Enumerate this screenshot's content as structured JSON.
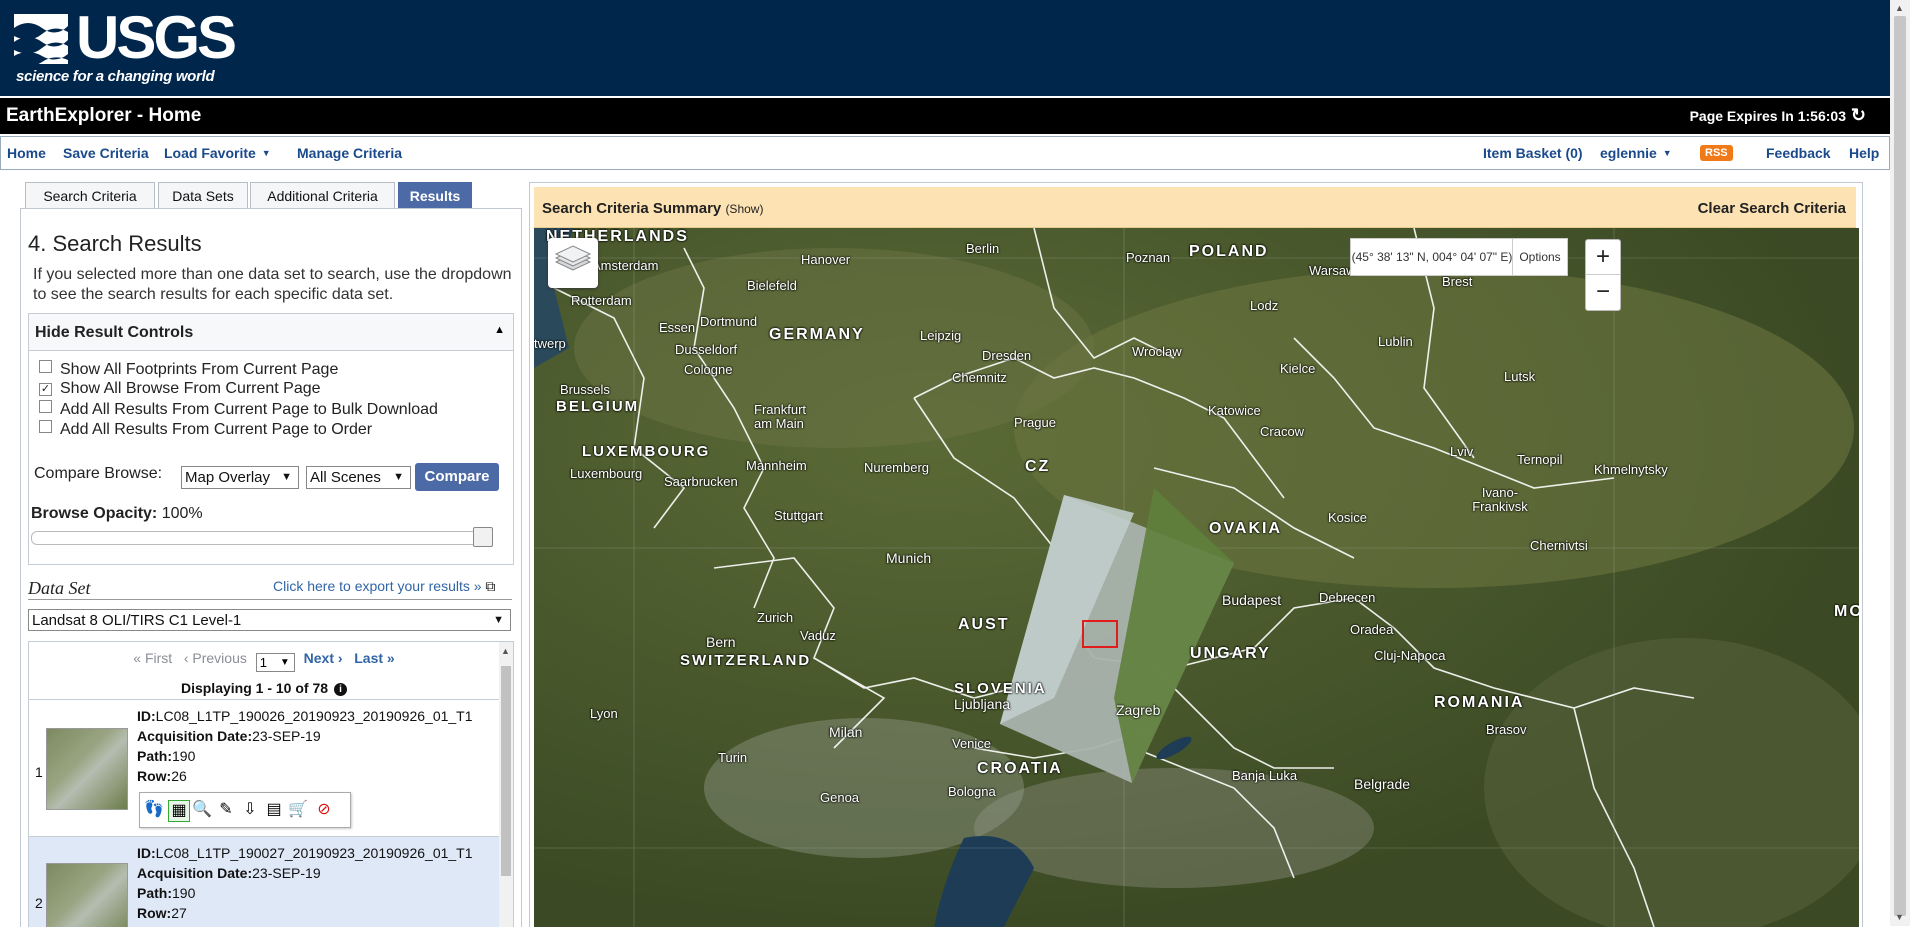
{
  "header": {
    "logo_text": "USGS",
    "logo_tagline": "science for a changing world",
    "app_title": "EarthExplorer - Home",
    "expiry_label": "Page Expires In 1:56:03",
    "refresh_icon": "refresh-icon"
  },
  "nav": {
    "home": "Home",
    "save_criteria": "Save Criteria",
    "load_favorite": "Load Favorite",
    "manage_criteria": "Manage Criteria",
    "item_basket": "Item Basket (0)",
    "user": "eglennie",
    "rss": "RSS",
    "feedback": "Feedback",
    "help": "Help"
  },
  "tabs": [
    {
      "label": "Search Criteria"
    },
    {
      "label": "Data Sets"
    },
    {
      "label": "Additional Criteria"
    },
    {
      "label": "Results",
      "active": true
    }
  ],
  "results_panel": {
    "title": "4. Search Results",
    "description": "If you selected more than one data set to search, use the dropdown to see the search results for each specific data set.",
    "controls_header": "Hide Result Controls",
    "checkboxes": [
      {
        "label": "Show All Footprints From Current Page",
        "checked": false
      },
      {
        "label": "Show All Browse From Current Page",
        "checked": true
      },
      {
        "label": "Add All Results From Current Page to Bulk Download",
        "checked": false
      },
      {
        "label": "Add All Results From Current Page to Order",
        "checked": false
      }
    ],
    "compare_label": "Compare Browse:",
    "compare_mode": "Map Overlay",
    "compare_scenes": "All Scenes",
    "compare_button": "Compare",
    "opacity_label": "Browse Opacity:",
    "opacity_value": "100%",
    "opacity_level": 1.0,
    "dataset_label": "Data Set",
    "export_link": "Click here to export your results »",
    "dataset_value": "Landsat 8 OLI/TIRS C1 Level-1",
    "pager": {
      "first": "« First",
      "previous": "‹ Previous",
      "page": "1",
      "next": "Next ›",
      "last": "Last »"
    },
    "displaying": "Displaying 1 - 10 of 78",
    "results": [
      {
        "num": "1",
        "id_label": "ID:",
        "id": "LC08_L1TP_190026_20190923_20190926_01_T1",
        "acq_label": "Acquisition Date:",
        "acq": "23-SEP-19",
        "path_label": "Path:",
        "path": "190",
        "row_label": "Row:",
        "row": "26"
      },
      {
        "num": "2",
        "id_label": "ID:",
        "id": "LC08_L1TP_190027_20190923_20190926_01_T1",
        "acq_label": "Acquisition Date:",
        "acq": "23-SEP-19",
        "path_label": "Path:",
        "path": "190",
        "row_label": "Row:",
        "row": "27"
      }
    ],
    "result_tool_icons": [
      "footprint-icon",
      "browse-overlay-icon",
      "show-metadata-icon",
      "compare-browse-icon",
      "download-icon",
      "bulk-download-icon",
      "add-to-cart-icon",
      "exclude-icon"
    ]
  },
  "map": {
    "summary_title": "Search Criteria Summary",
    "summary_toggle": "(Show)",
    "clear_label": "Clear Search Criteria",
    "coords": "(45° 38' 13\" N, 004° 04' 07\" E)",
    "options_label": "Options",
    "zoom_in": "+",
    "zoom_out": "−",
    "countries": [
      "NETHERLANDS",
      "POLAND",
      "GERMANY",
      "BELGIUM",
      "LUXEMBOURG",
      "CZ",
      "OVAKIA",
      "AUST",
      "UNGARY",
      "SWITZERLAND",
      "SLOVENIA",
      "ROMANIA",
      "CROATIA",
      "MO"
    ],
    "cities": [
      "Amsterdam",
      "Hanover",
      "Berlin",
      "Poznan",
      "Warsaw",
      "Brest",
      "Rotterdam",
      "Bielefeld",
      "Lodz",
      "Essen",
      "Dortmund",
      "Leipzig",
      "Dusseldorf",
      "Dresden",
      "Wroclaw",
      "Lublin",
      "twerp",
      "Cologne",
      "Chemnitz",
      "Kielce",
      "Lutsk",
      "Brussels",
      "Frankfurt am Main",
      "Katowice",
      "Prague",
      "Cracow",
      "Lviv",
      "Ternopil",
      "Khmelnytsky",
      "Luxembourg",
      "Saarbrucken",
      "Mannheim",
      "Nuremberg",
      "Ivano-Frankivsk",
      "Stuttgart",
      "Kosice",
      "Chernivtsi",
      "Munich",
      "Budapest",
      "Debrecen",
      "Zurich",
      "Vaduz",
      "Bern",
      "Oradea",
      "Cluj-Napoca",
      "Ljubljana",
      "Zagreb",
      "Lyon",
      "Milan",
      "Brasov",
      "Turin",
      "Venice",
      "Banja Luka",
      "Belgrade",
      "Genoa",
      "Bologna"
    ]
  }
}
